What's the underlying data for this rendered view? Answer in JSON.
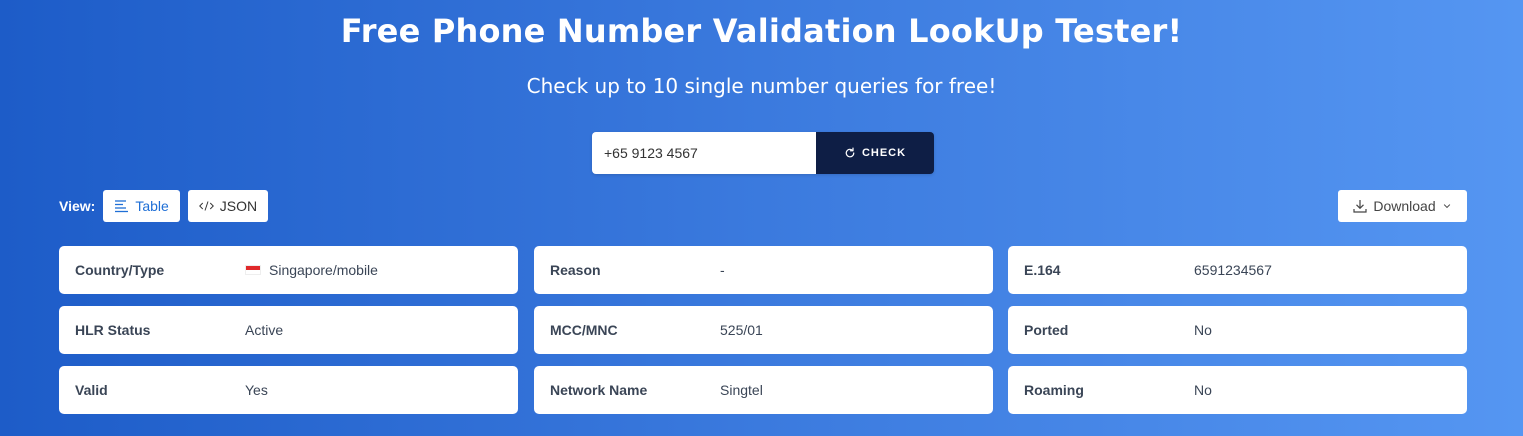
{
  "header": {
    "title": "Free Phone Number Validation LookUp Tester!",
    "subtitle": "Check up to 10 single number queries for free!"
  },
  "search": {
    "value": "+65 9123 4567",
    "check_label": "CHECK"
  },
  "view": {
    "label": "View:",
    "table_label": "Table",
    "json_label": "JSON",
    "active": "Table"
  },
  "download_label": "Download",
  "results": [
    {
      "key": "Country/Type",
      "value": "Singapore/mobile",
      "flag": "singapore-flag-icon"
    },
    {
      "key": "Reason",
      "value": "-"
    },
    {
      "key": "E.164",
      "value": "6591234567"
    },
    {
      "key": "HLR Status",
      "value": "Active"
    },
    {
      "key": "MCC/MNC",
      "value": "525/01"
    },
    {
      "key": "Ported",
      "value": "No"
    },
    {
      "key": "Valid",
      "value": "Yes"
    },
    {
      "key": "Network Name",
      "value": "Singtel"
    },
    {
      "key": "Roaming",
      "value": "No"
    }
  ],
  "colors": {
    "gradient_start": "#1d5cc8",
    "gradient_end": "#5596f2",
    "check_button": "#0e1e45",
    "active_view": "#1f6fd6",
    "text_dark": "#3a4556"
  }
}
